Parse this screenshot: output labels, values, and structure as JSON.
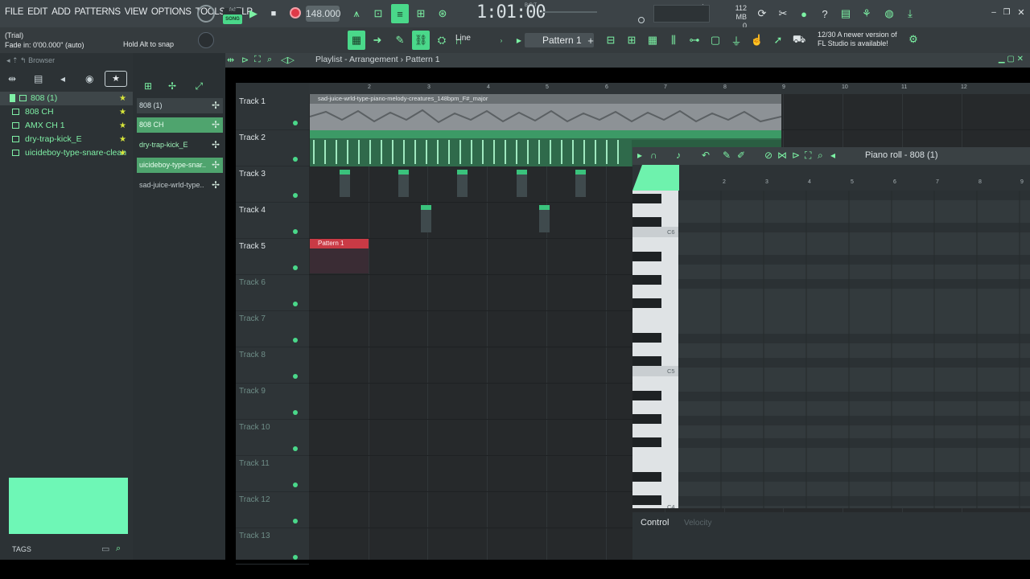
{
  "menu": [
    "FILE",
    "EDIT",
    "ADD",
    "PATTERNS",
    "VIEW",
    "OPTIONS",
    "TOOLS",
    "HELP"
  ],
  "status": {
    "trial": "(Trial)",
    "fade": "Fade in: 0'00.000\" (auto)",
    "snap_hint": "Hold Alt to snap"
  },
  "transport": {
    "mode_top": "PAT",
    "mode_label": "SONG",
    "bpm": "148.000",
    "time": "1:01:00",
    "time_unit": "B:S:T",
    "step_value": "1"
  },
  "memory": {
    "ram": "112 MB",
    "cpu": "0"
  },
  "notice": {
    "count": "12/30",
    "line1": "A newer version of",
    "line2": "FL Studio is available!"
  },
  "toolbar": {
    "snap_mode": "Line",
    "pattern": "Pattern 1"
  },
  "browser": {
    "title": "Browser",
    "items": [
      {
        "label": "808 (1)"
      },
      {
        "label": "808 CH"
      },
      {
        "label": "AMX CH 1"
      },
      {
        "label": "dry-trap-kick_E"
      },
      {
        "label": "uicideboy-type-snare-clean"
      }
    ],
    "tags_label": "TAGS"
  },
  "picker": {
    "items": [
      "808 (1)",
      "808 CH",
      "dry-trap-kick_E",
      "uicideboy-type-snar..",
      "sad-juice-wrld-type.."
    ]
  },
  "playlist": {
    "breadcrumb": "Playlist - Arrangement › Pattern 1",
    "ruler": [
      "2",
      "3",
      "4",
      "5",
      "6",
      "7",
      "8",
      "9",
      "10",
      "11",
      "12"
    ],
    "tracks": [
      "Track 1",
      "Track 2",
      "Track 3",
      "Track 4",
      "Track 5",
      "Track 6",
      "Track 7",
      "Track 8",
      "Track 9",
      "Track 10",
      "Track 11",
      "Track 12",
      "Track 13"
    ],
    "audio_clip": "sad-juice-wrld-type-piano-melody-creatures_148bpm_F#_major",
    "pattern_clip": "Pattern 1"
  },
  "piano_roll": {
    "title": "Piano roll - 808 (1)",
    "ruler": [
      "2",
      "3",
      "4",
      "5",
      "6",
      "7",
      "8",
      "9"
    ],
    "keys": [
      "C6",
      "C5",
      "C4"
    ],
    "control_label": "Control",
    "control_target": "Velocity"
  },
  "colors": {
    "accent": "#4ad88a",
    "pattern": "#c93a45",
    "background": "#26292b"
  }
}
